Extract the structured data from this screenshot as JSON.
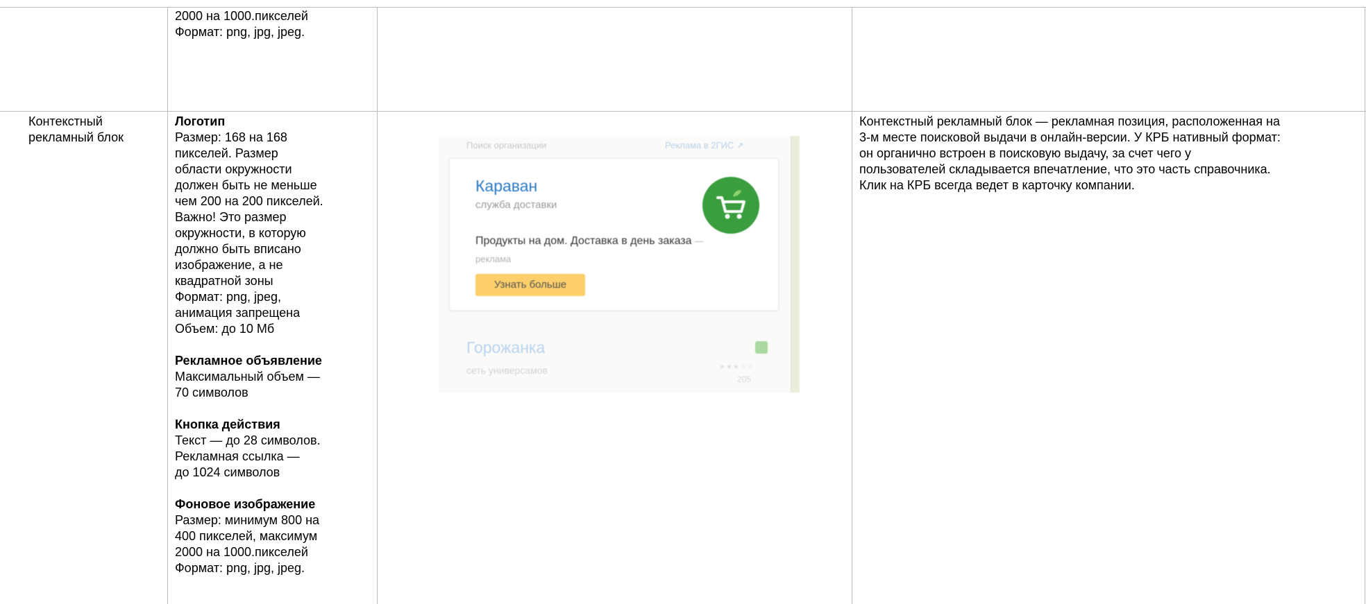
{
  "top_row": {
    "spec_lines": [
      "2000 на 1000.пикселей",
      "Формат: png, jpg, jpeg."
    ]
  },
  "row": {
    "name_lines": [
      "Контекстный",
      "рекламный блок"
    ],
    "logo": {
      "heading": "Логотип",
      "lines": [
        "Размер: 168 на 168",
        "пикселей. Размер",
        "области окружности",
        "должен быть не меньше",
        "чем 200 на 200 пикселей.",
        "Важно! Это размер",
        "окружности, в которую",
        "должно быть вписано",
        "изображение, а не",
        "квадратной зоны",
        "Формат: png, jpeg,",
        "анимация запрещена",
        "Объем: до 10 Мб"
      ]
    },
    "ad_text": {
      "heading": "Рекламное объявление",
      "lines": [
        "Максимальный объем —",
        "70 символов"
      ]
    },
    "action_button": {
      "heading": "Кнопка действия",
      "lines": [
        "Текст — до 28 символов.",
        "Рекламная ссылка —",
        "до 1024 символов"
      ]
    },
    "background": {
      "heading": "Фоновое изображение",
      "lines": [
        "Размер: минимум 800 на",
        "400 пикселей, максимум",
        "2000 на 1000.пикселей",
        "Формат: png, jpg, jpeg."
      ]
    },
    "description_lines": [
      "Контекстный рекламный блок — рекламная позиция, расположенная на",
      "3-м месте поисковой выдачи в онлайн-версии. У КРБ нативный формат:",
      "он органично встроен в поисковую выдачу, за счет чего у",
      "пользователей складывается впечатление, что это часть справочника.",
      "Клик на КРБ всегда ведет в карточку компании."
    ]
  },
  "preview": {
    "header_left": "Поиск организации",
    "header_right": "Реклама в 2ГИС ↗",
    "card": {
      "title": "Караван",
      "subtitle": "служба доставки",
      "text": "Продукты на дом. Доставка в день заказа",
      "ad_label": "— реклама",
      "button": "Узнать больше",
      "logo_color": "#3a9d3e",
      "button_color": "#fccf6a",
      "title_color": "#2a78c4"
    },
    "next_card": {
      "title": "Горожанка",
      "subtitle": "сеть универсамов",
      "rating": "★★★☆☆",
      "count": "205"
    }
  }
}
